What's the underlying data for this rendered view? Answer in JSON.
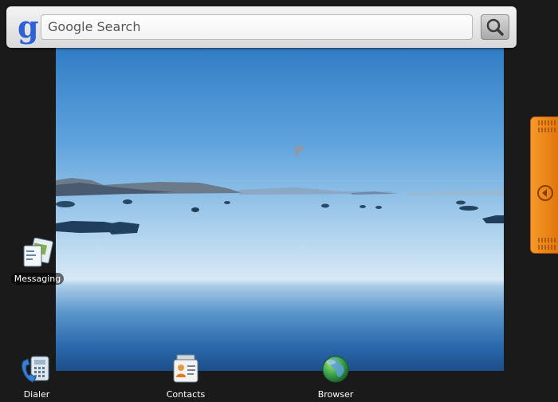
{
  "search": {
    "logo": "g",
    "placeholder": "Google Search"
  },
  "shortcuts": {
    "messaging": {
      "label": "Messaging"
    },
    "dialer": {
      "label": "Dialer"
    },
    "contacts": {
      "label": "Contacts"
    },
    "browser": {
      "label": "Browser"
    }
  },
  "icons": {
    "search": "magnifier-icon",
    "drawer": "chevron-left-circle-icon",
    "messaging": "messaging-icon",
    "dialer": "phone-icon",
    "contacts": "contacts-card-icon",
    "browser": "globe-icon"
  },
  "colors": {
    "drawer_handle": "#ef8a18",
    "google_blue": "#2e60d8",
    "background": "#1a1a1a"
  }
}
